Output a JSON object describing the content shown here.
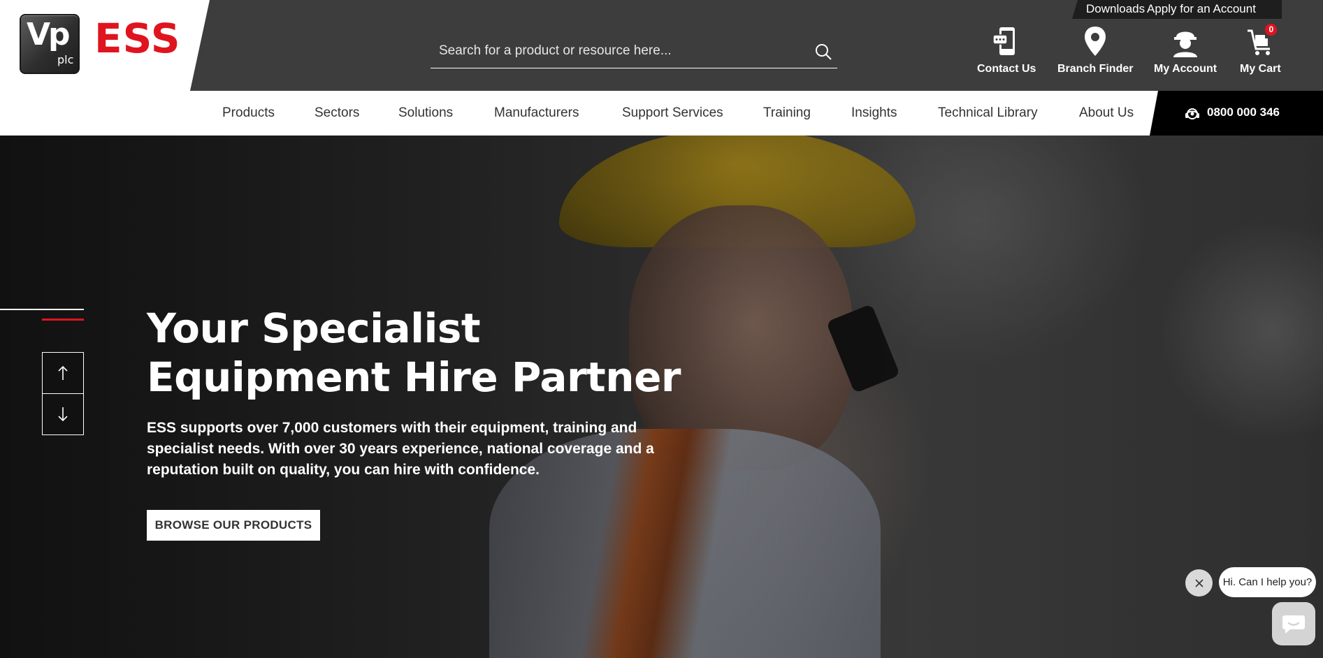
{
  "brand": {
    "vp_text": "Vp",
    "plc_text": "plc",
    "ess_text": "ESS"
  },
  "quicklinks": {
    "downloads": "Downloads",
    "apply": "Apply for an Account"
  },
  "search": {
    "placeholder": "Search for a product or resource here..."
  },
  "header_icons": {
    "contact": "Contact Us",
    "branch": "Branch Finder",
    "account": "My Account",
    "cart": "My Cart",
    "cart_count": "0"
  },
  "nav": {
    "items": [
      "Products",
      "Sectors",
      "Solutions",
      "Manufacturers",
      "Support Services",
      "Training",
      "Insights",
      "Technical Library",
      "About Us"
    ],
    "phone": "0800 000 346"
  },
  "hero": {
    "title_line1": "Your Specialist",
    "title_line2": "Equipment Hire Partner",
    "text": "ESS supports over 7,000 customers with their equipment, training and specialist needs. With over 30 years experience, national coverage and a reputation built on quality, you can hire with confidence.",
    "button": "BROWSE OUR PRODUCTS"
  },
  "chat": {
    "prompt": "Hi. Can I help you?"
  },
  "colors": {
    "brand_red": "#e0141e",
    "header_dark": "#3d3d3d",
    "phone_bar": "#000000"
  }
}
